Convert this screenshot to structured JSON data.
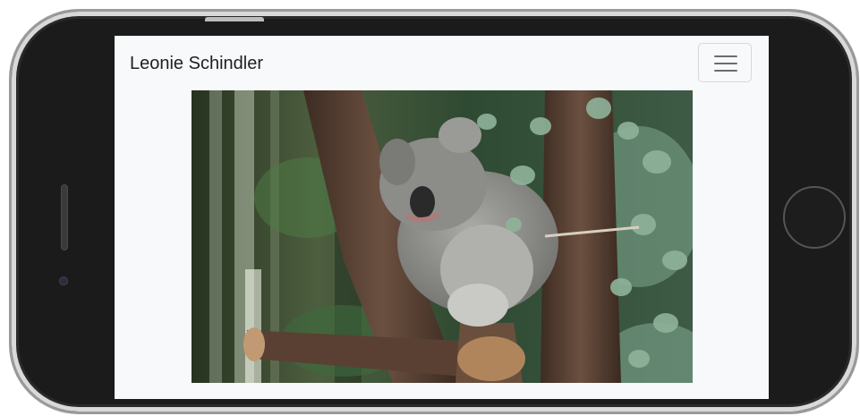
{
  "navbar": {
    "brand": "Leonie Schindler",
    "menu_icon": "hamburger-menu-icon"
  },
  "hero_image": {
    "subject": "koala-photo",
    "colors": {
      "foliage_dark": "#1f2b1c",
      "foliage": "#3f5a3a",
      "leaf": "#8fb39a",
      "bark": "#5e4636",
      "koala_fur": "#8f8f8c"
    }
  }
}
